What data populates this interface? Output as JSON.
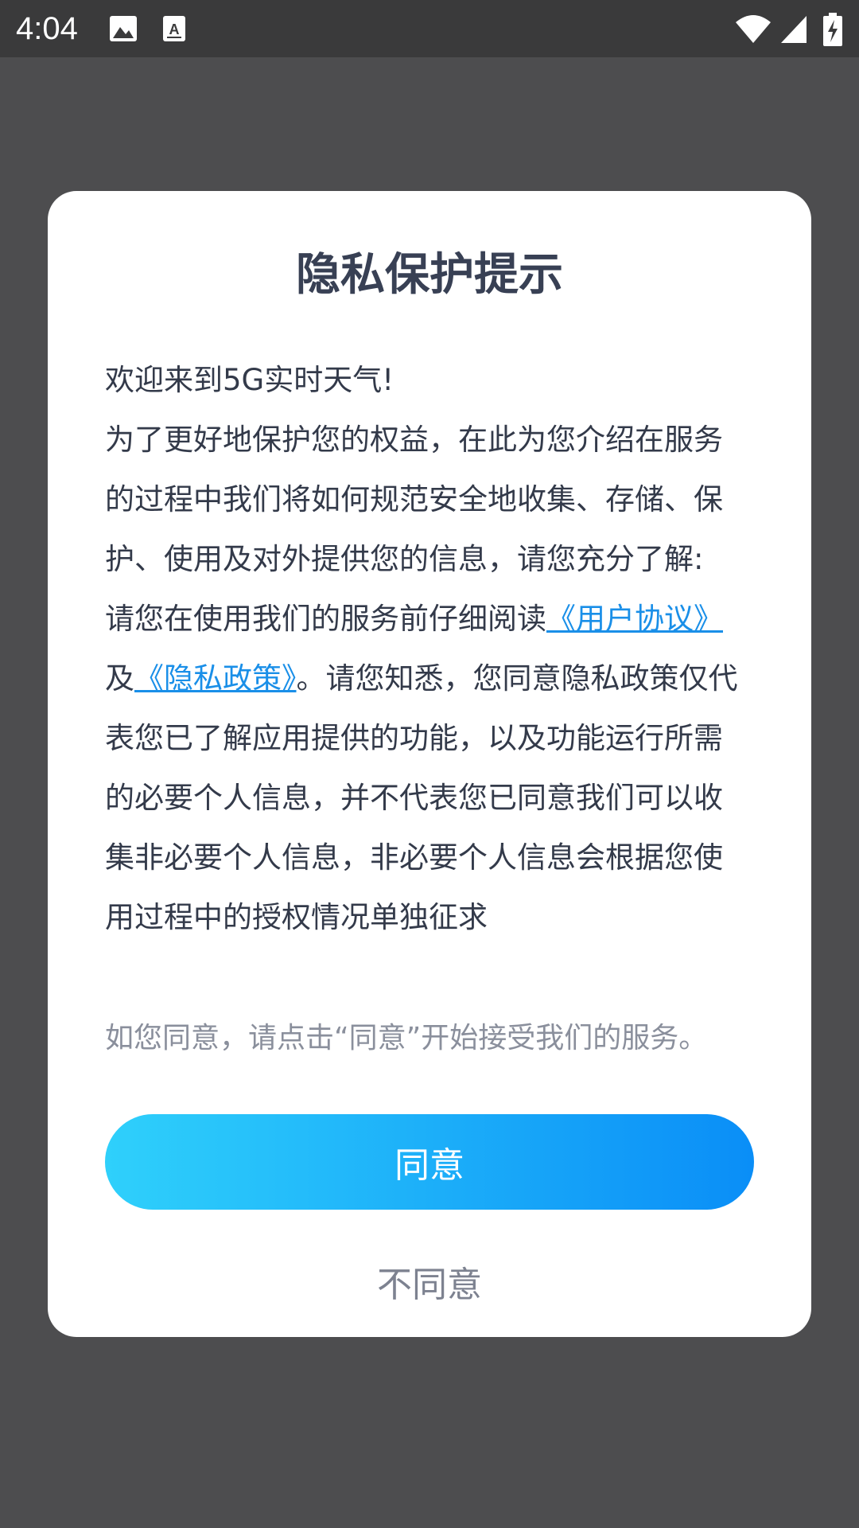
{
  "status_bar": {
    "time": "4:04",
    "icons": [
      "image-icon",
      "text-scan-icon",
      "wifi-icon",
      "cell-signal-icon",
      "battery-charging-icon"
    ]
  },
  "dialog": {
    "title": "隐私保护提示",
    "welcome": "欢迎来到5G实时天气!",
    "paragraph1": "为了更好地保护您的权益，在此为您介绍在服务的过程中我们将如何规范安全地收集、存储、保护、使用及对外提供您的信息，请您充分了解:",
    "paragraph2_prefix": "请您在使用我们的服务前仔细阅读",
    "link_user_agreement": "《用户协议》",
    "and_text": "及",
    "link_privacy_policy": "《隐私政策》",
    "paragraph2_suffix": "。请您知悉，您同意隐私政策仅代表您已了解应用提供的功能，以及功能运行所需的必要个人信息，并不代表您已同意我们可以收集非必要个人信息，非必要个人信息会根据您使用过程中的授权情况单独征求",
    "hint": "如您同意，请点击“同意”开始接受我们的服务。",
    "agree_label": "同意",
    "disagree_label": "不同意"
  },
  "colors": {
    "overlay": "#4d4d4f",
    "title": "#384054",
    "link": "#1a8fe8",
    "agree_gradient_start": "#2fd0fb",
    "agree_gradient_end": "#0a8ef7"
  }
}
